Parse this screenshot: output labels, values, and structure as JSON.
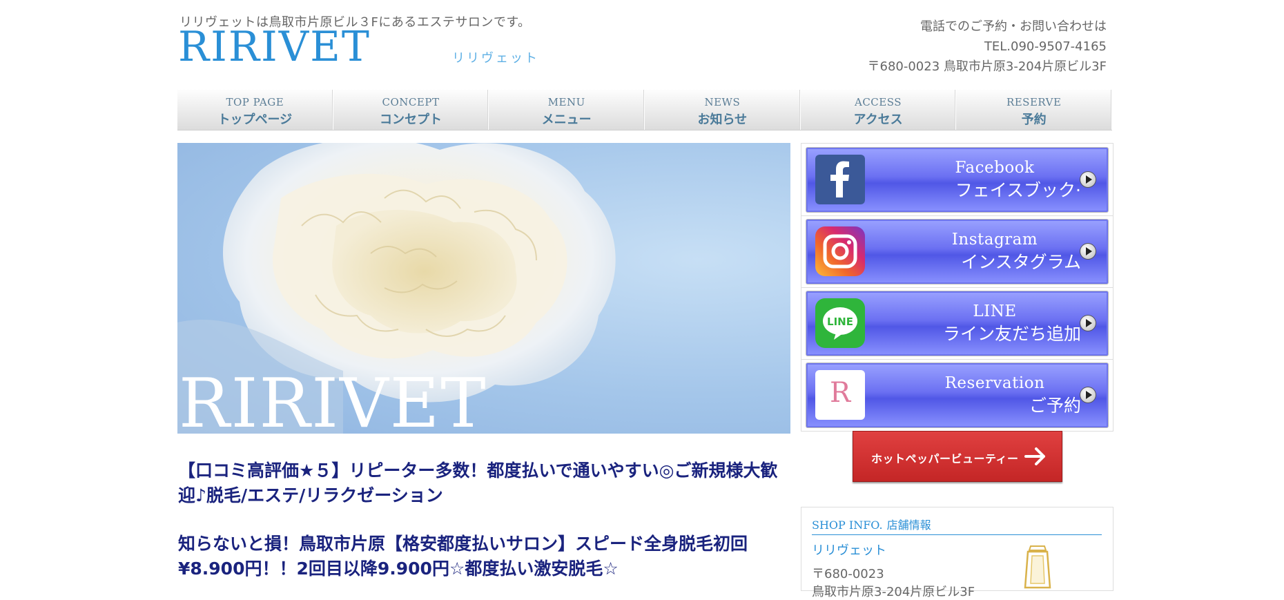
{
  "header": {
    "tagline": "リリヴェットは鳥取市片原ビル３Fにあるエステサロンです。",
    "logo": "RIRIVET",
    "logo_kana": "リリヴェット",
    "contact_line1": "電話でのご予約・お問い合わせは",
    "contact_tel": "TEL.090-9507-4165",
    "contact_address": "〒680-0023 鳥取市片原3-204片原ビル3F"
  },
  "nav": [
    {
      "en": "TOP PAGE",
      "ja": "トップページ"
    },
    {
      "en": "CONCEPT",
      "ja": "コンセプト"
    },
    {
      "en": "MENU",
      "ja": "メニュー"
    },
    {
      "en": "NEWS",
      "ja": "お知らせ"
    },
    {
      "en": "ACCESS",
      "ja": "アクセス"
    },
    {
      "en": "RESERVE",
      "ja": "予約"
    }
  ],
  "hero": {
    "text": "RIRIVET"
  },
  "social": [
    {
      "en": "Facebook",
      "ja": "フェイスブック·",
      "icon": "facebook-icon",
      "color": "#3b5998"
    },
    {
      "en": "Instagram",
      "ja": "インスタグラム",
      "icon": "instagram-icon",
      "color": "#c13584"
    },
    {
      "en": "LINE",
      "ja": "ライン友だち追加",
      "icon": "line-icon",
      "color": "#2fb53b"
    },
    {
      "en": "Reservation",
      "ja": "ご予約",
      "icon": "ririvet-r-logo-icon",
      "color": "#e07b9b"
    }
  ],
  "hotpepper": {
    "label": "ホットペッパービューティー"
  },
  "headlines": [
    "【口コミ高評価★５】リピーター多数！都度払いで通いやすい◎ご新規様大歓迎♪脱毛/エステ/リラクゼーション",
    "知らないと損！鳥取市片原【格安都度払いサロン】スピード全身脱毛初回¥8.900円！！2回目以降9.900円☆都度払い激安脱毛☆"
  ],
  "shop": {
    "title_en": "SHOP INFO.",
    "title_ja": "店舗情報",
    "name": "リリヴェット",
    "zip": "〒680-0023",
    "address": "鳥取市片原3-204片原ビル3F"
  }
}
